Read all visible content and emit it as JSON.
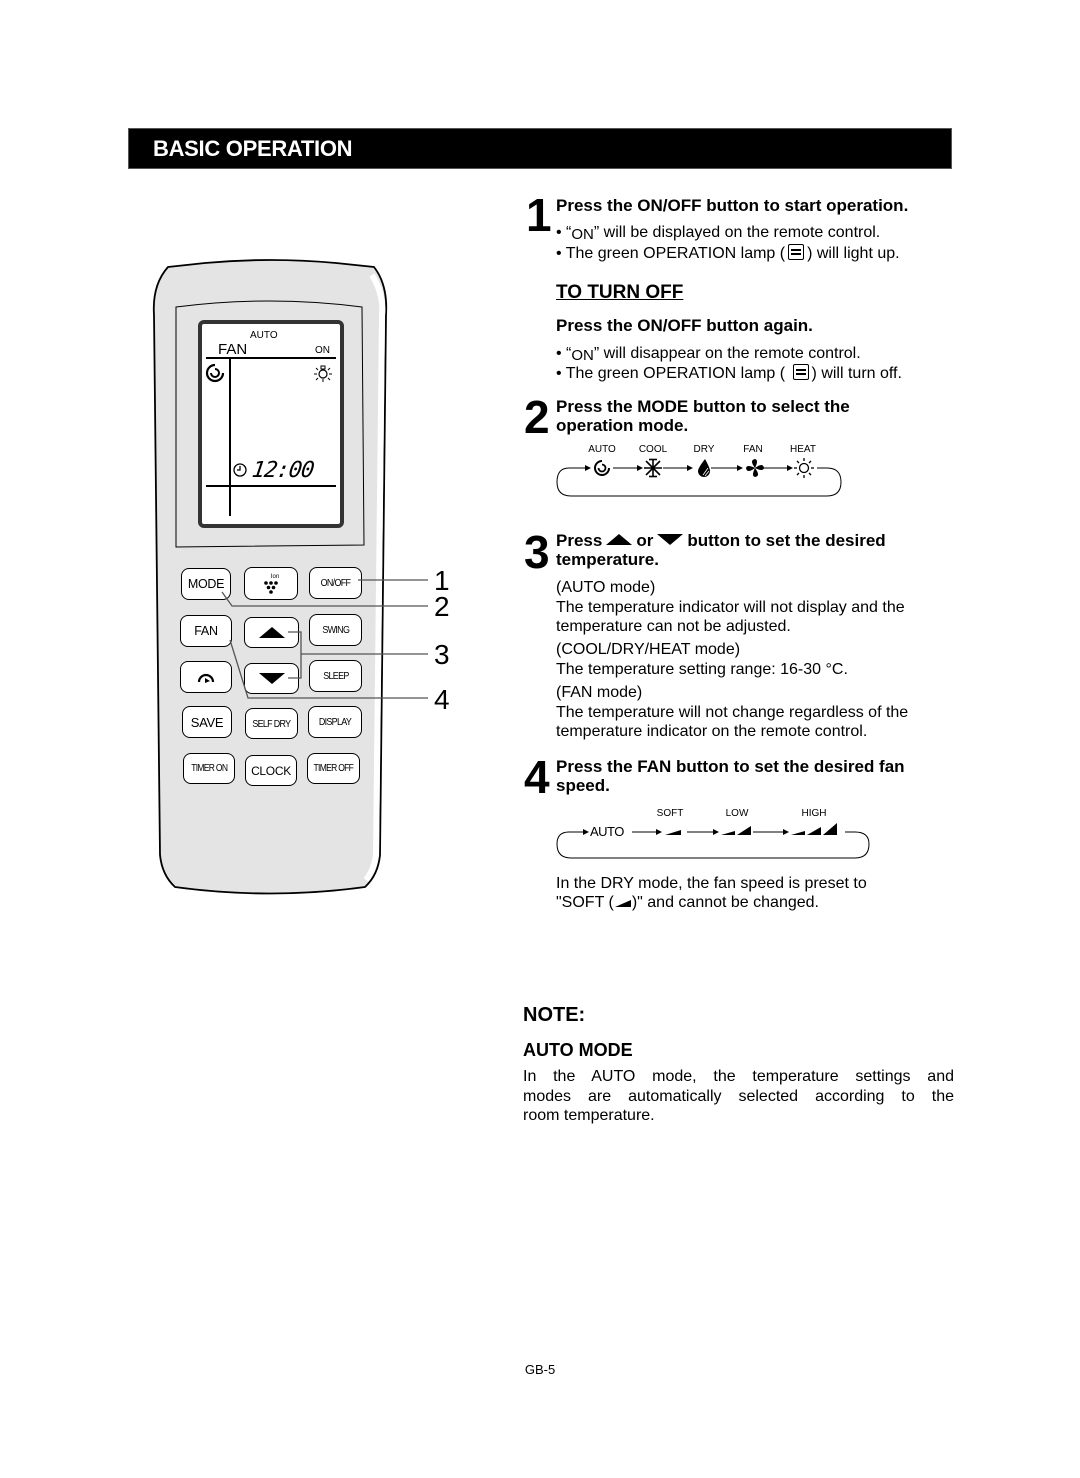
{
  "header": {
    "title": "BASIC OPERATION"
  },
  "steps": {
    "s1": {
      "number": "1",
      "heading": "Press the ON/OFF button to start operation.",
      "b1_pre": "• “",
      "b1_on": "ON",
      "b1_post": "” will be displayed on the remote control.",
      "b2_pre": "• The green OPERATION lamp (",
      "b2_post": ") will light up."
    },
    "turn_off": {
      "heading": "TO TURN OFF",
      "subheading": "Press the ON/OFF button again.",
      "b1_pre": "• “",
      "b1_on": "ON",
      "b1_post": "” will disappear on the remote control.",
      "b2_pre": "• The green OPERATION lamp (",
      "b2_post": ") will turn off."
    },
    "s2": {
      "number": "2",
      "heading_l1": "Press the MODE button to select the",
      "heading_l2": "operation mode.",
      "modes": [
        "AUTO",
        "COOL",
        "DRY",
        "FAN",
        "HEAT"
      ]
    },
    "s3": {
      "number": "3",
      "heading_pre": "Press",
      "heading_mid": "or",
      "heading_post": "button to set the desired",
      "heading_l2": "temperature.",
      "auto_label": "(AUTO mode)",
      "auto_text_l1": "The temperature indicator will not display and the",
      "auto_text_l2": "temperature can not be adjusted.",
      "cool_label": "(COOL/DRY/HEAT mode)",
      "cool_text": "The temperature setting range: 16-30 °C.",
      "fan_label": "(FAN mode)",
      "fan_text_l1": "The temperature will not change regardless of the",
      "fan_text_l2": "temperature indicator on the remote control."
    },
    "s4": {
      "number": "4",
      "heading_l1": "Press the FAN button to set the desired fan",
      "heading_l2": "speed.",
      "speeds": [
        "AUTO",
        "SOFT",
        "LOW",
        "HIGH"
      ],
      "dry_note_l1": "In the DRY mode, the fan speed is preset to",
      "dry_note_l2_pre": "\"SOFT (",
      "dry_note_l2_post": ")\" and cannot be changed."
    }
  },
  "note": {
    "title": "NOTE:",
    "subtitle": "AUTO MODE",
    "text_l1": "In the AUTO mode, the temperature settings and",
    "text_l2": "modes are automatically selected according to the",
    "text_l3": "room temperature."
  },
  "remote": {
    "lcd": {
      "auto": "AUTO",
      "fan": "FAN",
      "on": "ON",
      "clock": "12:00"
    },
    "buttons": {
      "mode": "MODE",
      "ion": "Ion",
      "onoff": "ON/OFF",
      "fan": "FAN",
      "swing": "SWING",
      "sleep": "SLEEP",
      "save": "SAVE",
      "selfdry": "SELF DRY",
      "display": "DISPLAY",
      "timeron": "TIMER ON",
      "clock": "CLOCK",
      "timeroff": "TIMER OFF"
    },
    "callouts": [
      "1",
      "2",
      "3",
      "4"
    ]
  },
  "footer": {
    "page": "GB-5"
  }
}
